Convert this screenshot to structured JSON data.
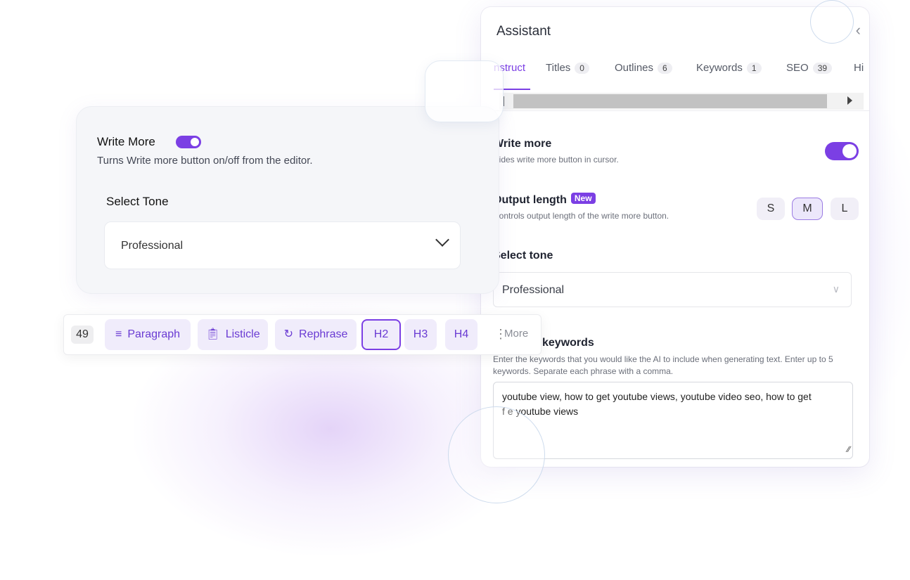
{
  "assistant": {
    "title": "Assistant",
    "close_icon": "chevron-left-icon",
    "tabs": [
      {
        "label": "nstruct",
        "count": null,
        "active": true
      },
      {
        "label": "Titles",
        "count": "0"
      },
      {
        "label": "Outlines",
        "count": "6"
      },
      {
        "label": "Keywords",
        "count": "1"
      },
      {
        "label": "SEO",
        "count": "39"
      },
      {
        "label": "Hi",
        "count": null
      }
    ],
    "write_more": {
      "label": "Write more",
      "subtitle": "Hides write more button in cursor.",
      "enabled": true
    },
    "output_length": {
      "label": "Output length",
      "badge": "New",
      "subtitle": "Controls output length of the write more button.",
      "options": [
        "S",
        "M",
        "L"
      ],
      "selected": "M"
    },
    "select_tone": {
      "label": "Select tone",
      "value": "Professional"
    },
    "keywords": {
      "label": "keywords",
      "description": "Enter the keywords that you would like the AI to include when generating text. Enter up to 5 keywords. Separate each phrase with a comma.",
      "value_line1": "youtube view, how to get youtube views, youtube video seo, how to get",
      "value_line2": "f  e youtube views"
    }
  },
  "card": {
    "title": "Write More",
    "subtitle": "Turns Write more button on/off from the editor.",
    "toggle_on": true,
    "tone_label": "Select Tone",
    "tone_value": "Professional"
  },
  "toolbar": {
    "count": "49",
    "buttons": [
      {
        "label": "Paragraph",
        "icon": "lines-icon"
      },
      {
        "label": "Listicle",
        "icon": "clipboard-icon"
      },
      {
        "label": "Rephrase",
        "icon": "refresh-icon"
      },
      {
        "label": "H2",
        "selected": true
      },
      {
        "label": "H3"
      },
      {
        "label": "H4"
      }
    ],
    "more_label": "More"
  },
  "colors": {
    "accent": "#7b3fe4",
    "accent_soft": "#f0ecfb"
  }
}
